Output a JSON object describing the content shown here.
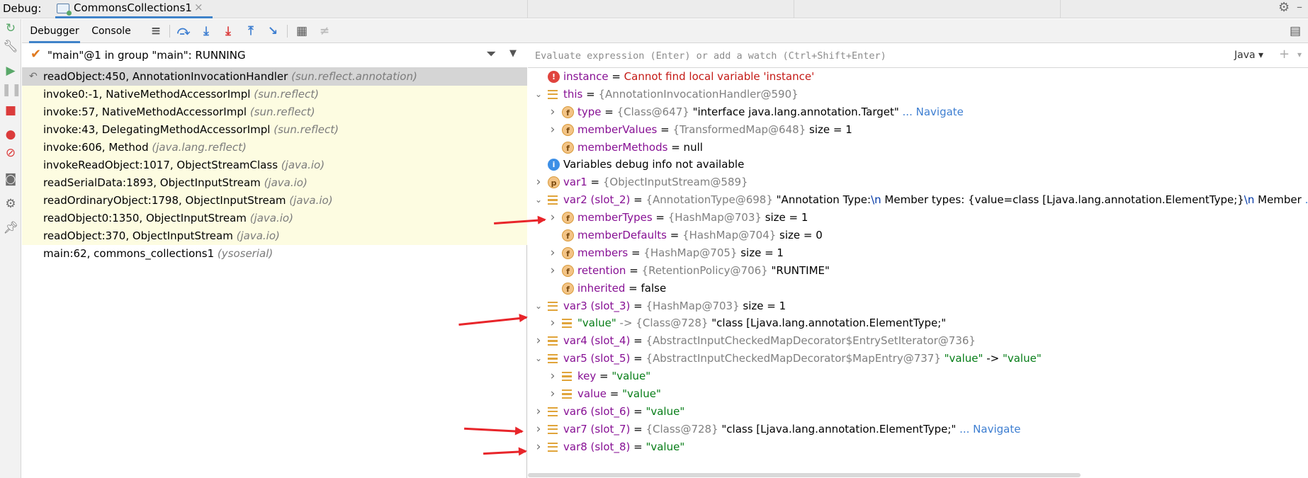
{
  "titlebar": {
    "label": "Debug:",
    "tab_title": "CommonsCollections1",
    "tab_close": "×"
  },
  "subbar": {
    "tab_debugger": "Debugger",
    "tab_console": "Console"
  },
  "thread": {
    "status_text": "\"main\"@1 in group \"main\": RUNNING"
  },
  "frames": [
    {
      "method": "readObject:450, AnnotationInvocationHandler",
      "pkg": "(sun.reflect.annotation)",
      "style": "selected"
    },
    {
      "method": "invoke0:-1, NativeMethodAccessorImpl",
      "pkg": "(sun.reflect)",
      "style": "yellow"
    },
    {
      "method": "invoke:57, NativeMethodAccessorImpl",
      "pkg": "(sun.reflect)",
      "style": "yellow"
    },
    {
      "method": "invoke:43, DelegatingMethodAccessorImpl",
      "pkg": "(sun.reflect)",
      "style": "yellow"
    },
    {
      "method": "invoke:606, Method",
      "pkg": "(java.lang.reflect)",
      "style": "yellow"
    },
    {
      "method": "invokeReadObject:1017, ObjectStreamClass",
      "pkg": "(java.io)",
      "style": "yellow"
    },
    {
      "method": "readSerialData:1893, ObjectInputStream",
      "pkg": "(java.io)",
      "style": "yellow"
    },
    {
      "method": "readOrdinaryObject:1798, ObjectInputStream",
      "pkg": "(java.io)",
      "style": "yellow"
    },
    {
      "method": "readObject0:1350, ObjectInputStream",
      "pkg": "(java.io)",
      "style": "yellow"
    },
    {
      "method": "readObject:370, ObjectInputStream",
      "pkg": "(java.io)",
      "style": "yellow"
    },
    {
      "method": "main:62, commons_collections1",
      "pkg": "(ysoserial)",
      "style": "plain"
    }
  ],
  "evaluate": {
    "placeholder": "Evaluate expression (Enter) or add a watch (Ctrl+Shift+Enter)",
    "language": "Java"
  },
  "variables": [
    {
      "level": 0,
      "toggle": "",
      "icon": "err",
      "parts": [
        [
          "vname",
          "instance"
        ],
        [
          "vplain",
          " = "
        ],
        [
          "verr",
          "Cannot find local variable 'instance'"
        ]
      ]
    },
    {
      "level": 0,
      "toggle": "open",
      "icon": "lines",
      "parts": [
        [
          "vname",
          "this"
        ],
        [
          "vplain",
          " = "
        ],
        [
          "vtype",
          "{AnnotationInvocationHandler@590}"
        ]
      ]
    },
    {
      "level": 1,
      "toggle": "closed",
      "icon": "f",
      "parts": [
        [
          "vname",
          "type"
        ],
        [
          "vplain",
          " = "
        ],
        [
          "vtype",
          "{Class@647} "
        ],
        [
          "vplain",
          "\"interface java.lang.annotation.Target\""
        ],
        [
          "vnav",
          " ... Navigate"
        ]
      ]
    },
    {
      "level": 1,
      "toggle": "closed",
      "icon": "f",
      "parts": [
        [
          "vname",
          "memberValues"
        ],
        [
          "vplain",
          " = "
        ],
        [
          "vtype",
          "{TransformedMap@648} "
        ],
        [
          "vplain",
          " size = 1"
        ]
      ]
    },
    {
      "level": 1,
      "toggle": "",
      "icon": "f",
      "parts": [
        [
          "vname",
          "memberMethods"
        ],
        [
          "vplain",
          " = null"
        ]
      ]
    },
    {
      "level": 0,
      "toggle": "",
      "icon": "info",
      "parts": [
        [
          "vplain",
          "Variables debug info not available"
        ]
      ]
    },
    {
      "level": 0,
      "toggle": "closed",
      "icon": "p",
      "parts": [
        [
          "vname",
          "var1"
        ],
        [
          "vplain",
          " = "
        ],
        [
          "vtype",
          "{ObjectInputStream@589}"
        ]
      ]
    },
    {
      "level": 0,
      "toggle": "open",
      "icon": "lines",
      "parts": [
        [
          "vname",
          "var2 (slot_2)"
        ],
        [
          "vplain",
          " = "
        ],
        [
          "vtype",
          "{AnnotationType@698} "
        ],
        [
          "vplain",
          "\"Annotation Type:"
        ],
        [
          "vesc",
          "\\n"
        ],
        [
          "vplain",
          "   Member types: {value=class [Ljava.lang.annotation.ElementType;}"
        ],
        [
          "vesc",
          "\\n"
        ],
        [
          "vplain",
          "   Member "
        ],
        [
          "vnav",
          "... View"
        ]
      ]
    },
    {
      "level": 1,
      "toggle": "closed",
      "icon": "f",
      "parts": [
        [
          "vname",
          "memberTypes"
        ],
        [
          "vplain",
          " = "
        ],
        [
          "vtype",
          "{HashMap@703} "
        ],
        [
          "vplain",
          " size = 1"
        ]
      ]
    },
    {
      "level": 1,
      "toggle": "",
      "icon": "f",
      "parts": [
        [
          "vname",
          "memberDefaults"
        ],
        [
          "vplain",
          " = "
        ],
        [
          "vtype",
          "{HashMap@704} "
        ],
        [
          "vplain",
          " size = 0"
        ]
      ]
    },
    {
      "level": 1,
      "toggle": "closed",
      "icon": "f",
      "parts": [
        [
          "vname",
          "members"
        ],
        [
          "vplain",
          " = "
        ],
        [
          "vtype",
          "{HashMap@705} "
        ],
        [
          "vplain",
          " size = 1"
        ]
      ]
    },
    {
      "level": 1,
      "toggle": "closed",
      "icon": "f",
      "parts": [
        [
          "vname",
          "retention"
        ],
        [
          "vplain",
          " = "
        ],
        [
          "vtype",
          "{RetentionPolicy@706} "
        ],
        [
          "vplain",
          "\"RUNTIME\""
        ]
      ]
    },
    {
      "level": 1,
      "toggle": "",
      "icon": "f",
      "parts": [
        [
          "vname",
          "inherited"
        ],
        [
          "vplain",
          " = false"
        ]
      ]
    },
    {
      "level": 0,
      "toggle": "open",
      "icon": "lines",
      "parts": [
        [
          "vname",
          "var3 (slot_3)"
        ],
        [
          "vplain",
          " = "
        ],
        [
          "vtype",
          "{HashMap@703} "
        ],
        [
          "vplain",
          " size = 1"
        ]
      ]
    },
    {
      "level": 1,
      "toggle": "closed",
      "icon": "lines",
      "parts": [
        [
          "vstr",
          "\"value\""
        ],
        [
          "vtype",
          " -> {Class@728} "
        ],
        [
          "vplain",
          "\"class [Ljava.lang.annotation.ElementType;\""
        ]
      ]
    },
    {
      "level": 0,
      "toggle": "closed",
      "icon": "lines",
      "parts": [
        [
          "vname",
          "var4 (slot_4)"
        ],
        [
          "vplain",
          " = "
        ],
        [
          "vtype",
          "{AbstractInputCheckedMapDecorator$EntrySetIterator@736}"
        ]
      ]
    },
    {
      "level": 0,
      "toggle": "open",
      "icon": "lines",
      "parts": [
        [
          "vname",
          "var5 (slot_5)"
        ],
        [
          "vplain",
          " = "
        ],
        [
          "vtype",
          "{AbstractInputCheckedMapDecorator$MapEntry@737} "
        ],
        [
          "vstr",
          "\"value\""
        ],
        [
          "vplain",
          " -> "
        ],
        [
          "vstr",
          "\"value\""
        ]
      ]
    },
    {
      "level": 1,
      "toggle": "closed",
      "icon": "lines",
      "parts": [
        [
          "vname",
          "key"
        ],
        [
          "vplain",
          " = "
        ],
        [
          "vstr",
          "\"value\""
        ]
      ]
    },
    {
      "level": 1,
      "toggle": "closed",
      "icon": "lines",
      "parts": [
        [
          "vname",
          "value"
        ],
        [
          "vplain",
          " = "
        ],
        [
          "vstr",
          "\"value\""
        ]
      ]
    },
    {
      "level": 0,
      "toggle": "closed",
      "icon": "lines",
      "parts": [
        [
          "vname",
          "var6 (slot_6)"
        ],
        [
          "vplain",
          " = "
        ],
        [
          "vstr",
          "\"value\""
        ]
      ]
    },
    {
      "level": 0,
      "toggle": "closed",
      "icon": "lines",
      "parts": [
        [
          "vname",
          "var7 (slot_7)"
        ],
        [
          "vplain",
          " = "
        ],
        [
          "vtype",
          "{Class@728} "
        ],
        [
          "vplain",
          "\"class [Ljava.lang.annotation.ElementType;\""
        ],
        [
          "vnav",
          " ... Navigate"
        ]
      ]
    },
    {
      "level": 0,
      "toggle": "closed",
      "icon": "lines",
      "parts": [
        [
          "vname",
          "var8 (slot_8)"
        ],
        [
          "vplain",
          " = "
        ],
        [
          "vstr",
          "\"value\""
        ]
      ]
    }
  ],
  "icons": {
    "rerun": "rerun-icon",
    "resume": "resume-icon",
    "pause": "pause-icon",
    "stop": "stop-icon",
    "step_over": "step-over-icon",
    "step_into": "step-into-icon",
    "force_step_into": "force-step-into-icon",
    "step_out": "step-out-icon",
    "run_to_cursor": "run-to-cursor-icon",
    "evaluate": "calculator-icon"
  },
  "colors": {
    "accent": "#4083c9",
    "frame_highlight": "#fdfce1",
    "selected_frame": "#d5d5d5",
    "annotation_arrow": "#e8252a"
  }
}
